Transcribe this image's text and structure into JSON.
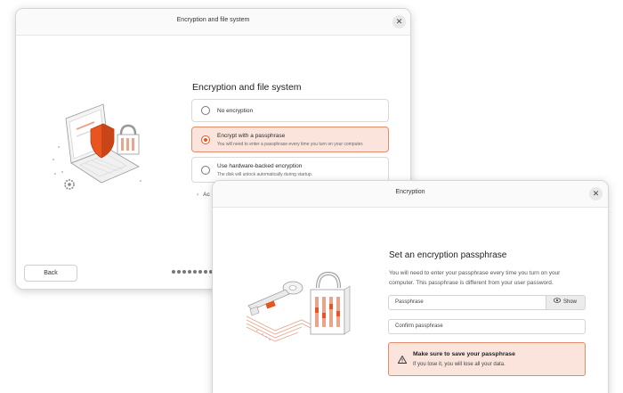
{
  "window1": {
    "title": "Encryption and file system",
    "close_icon": "close-icon",
    "heading": "Encryption and file system",
    "options": [
      {
        "label": "No encryption",
        "description": "",
        "selected": false
      },
      {
        "label": "Encrypt with a passphrase",
        "description": "You will need to enter a passphrase every time you turn on your computer.",
        "selected": true
      },
      {
        "label": "Use hardware-backed encryption",
        "description": "The disk will unlock automatically during startup.",
        "selected": false
      }
    ],
    "advanced_label": "Ac",
    "back_label": "Back",
    "progress_dots": 11,
    "illustration": "laptop-shield-lock-illustration"
  },
  "window2": {
    "title": "Encryption",
    "close_icon": "close-icon",
    "heading": "Set an encryption passphrase",
    "description": "You will need to enter your passphrase every time you turn on your computer. This passphrase is different from your user password.",
    "passphrase_placeholder": "Passphrase",
    "show_label": "Show",
    "show_icon": "eye-icon",
    "confirm_placeholder": "Confirm passphrase",
    "warning_icon": "warning-icon",
    "warning_title": "Make sure to save your passphrase",
    "warning_text": "If you lose it, you will lose all your data.",
    "illustration": "key-padlock-illustration"
  },
  "colors": {
    "accent": "#e95420",
    "selected_bg": "#fbe4dc",
    "selected_border": "#e48b6b"
  }
}
